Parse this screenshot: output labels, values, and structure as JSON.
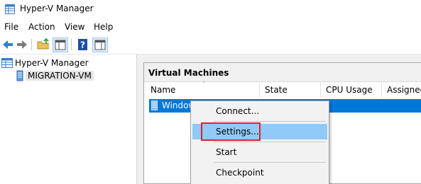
{
  "window": {
    "title": "Hyper-V Manager"
  },
  "menu": [
    "File",
    "Action",
    "View",
    "Help"
  ],
  "toolbar": [
    "back-icon",
    "forward-icon",
    "up-folder-icon",
    "show-hide-console-tree-icon",
    "help-icon",
    "show-hide-action-pane-icon"
  ],
  "tree": {
    "root": "Hyper-V Manager",
    "server": "MIGRATION-VM"
  },
  "vm_panel": {
    "title": "Virtual Machines",
    "columns": [
      "Name",
      "State",
      "CPU Usage",
      "Assigned"
    ],
    "rows": [
      {
        "name": "Windows"
      }
    ]
  },
  "context_menu": {
    "items": [
      "Connect...",
      "Settings...",
      "Start",
      "Checkpoint"
    ],
    "highlighted": "Settings..."
  },
  "colors": {
    "selection": "#0078d7",
    "menu_highlight": "#91c9f7",
    "annotation": "#d9262e"
  }
}
